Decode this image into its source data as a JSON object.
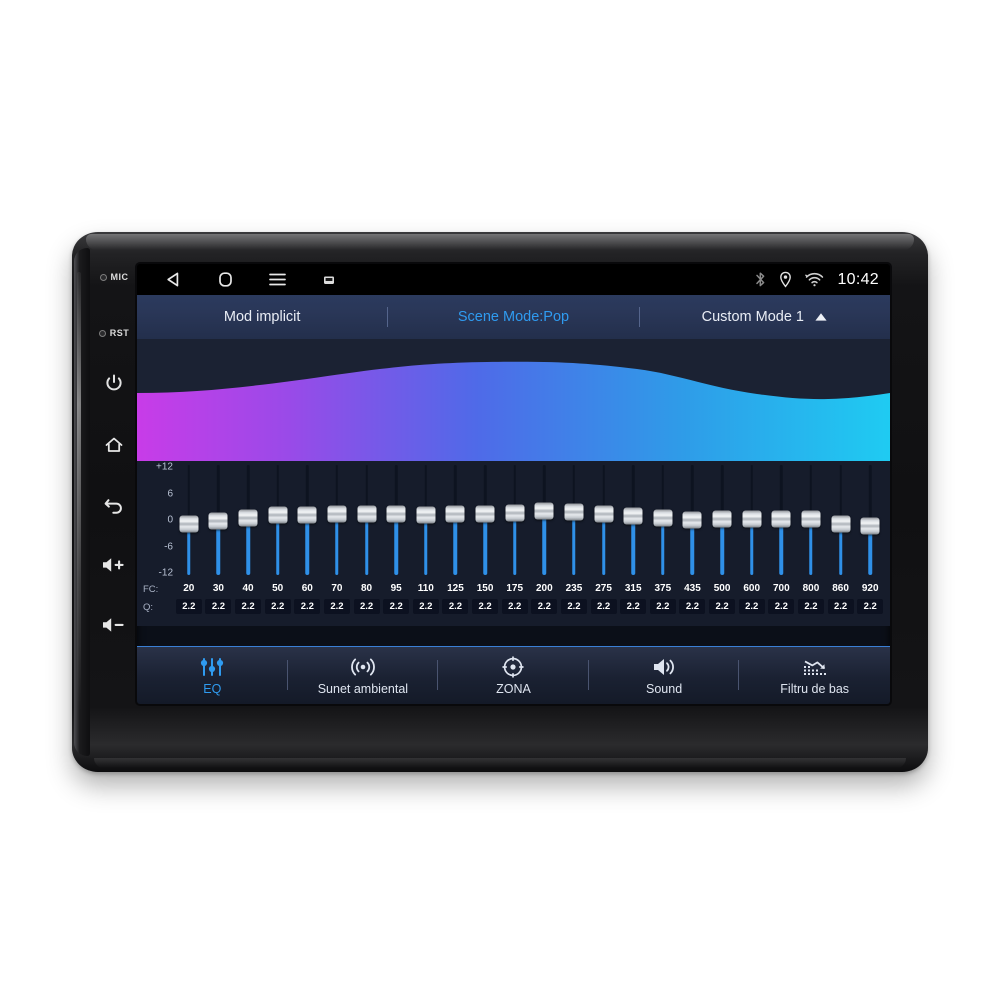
{
  "device": {
    "side_buttons": [
      {
        "name": "mic",
        "label": "MIC",
        "type": "dot"
      },
      {
        "name": "reset",
        "label": "RST",
        "type": "dot"
      },
      {
        "name": "power",
        "label": "",
        "type": "power-icon"
      },
      {
        "name": "home",
        "label": "",
        "type": "home-icon"
      },
      {
        "name": "back",
        "label": "",
        "type": "back-icon"
      },
      {
        "name": "volume-up",
        "label": "+",
        "type": "volume-up-icon"
      },
      {
        "name": "volume-down",
        "label": "−",
        "type": "volume-down-icon"
      }
    ]
  },
  "statusbar": {
    "nav": [
      {
        "name": "back-icon",
        "glyph": "triangle-left"
      },
      {
        "name": "home-icon",
        "glyph": "squircle"
      },
      {
        "name": "recents-menu-icon",
        "glyph": "hamburger"
      },
      {
        "name": "screenshot-icon",
        "glyph": "small-screen"
      }
    ],
    "indicators": [
      {
        "name": "bluetooth-icon"
      },
      {
        "name": "location-icon"
      },
      {
        "name": "wifi-icon"
      }
    ],
    "clock": "10:42"
  },
  "modebar": {
    "default_mode_label": "Mod implicit",
    "scene_mode_label": "Scene Mode:Pop",
    "custom_mode_label": "Custom Mode 1",
    "expand_caret": "caret-up-icon",
    "active_color": "#2f9bf0"
  },
  "wave": {
    "gradient_start": "#c040e8",
    "gradient_mid": "#4f6ae8",
    "gradient_end": "#22c6f0",
    "background": "#1b2233"
  },
  "equalizer": {
    "scale_labels": [
      "+12",
      "6",
      "0",
      "-6",
      "-12"
    ],
    "fc_row_label": "FC:",
    "q_row_label": "Q:",
    "range_db": [
      -12,
      12
    ],
    "bands": [
      {
        "fc": "20",
        "q": "2.2",
        "gain": -0.9
      },
      {
        "fc": "30",
        "q": "2.2",
        "gain": -0.2
      },
      {
        "fc": "40",
        "q": "2.2",
        "gain": 0.5
      },
      {
        "fc": "50",
        "q": "2.2",
        "gain": 1.1
      },
      {
        "fc": "60",
        "q": "2.2",
        "gain": 1.1
      },
      {
        "fc": "70",
        "q": "2.2",
        "gain": 1.3
      },
      {
        "fc": "80",
        "q": "2.2",
        "gain": 1.3
      },
      {
        "fc": "95",
        "q": "2.2",
        "gain": 1.3
      },
      {
        "fc": "110",
        "q": "2.2",
        "gain": 1.1
      },
      {
        "fc": "125",
        "q": "2.2",
        "gain": 1.4
      },
      {
        "fc": "150",
        "q": "2.2",
        "gain": 1.4
      },
      {
        "fc": "175",
        "q": "2.2",
        "gain": 1.5
      },
      {
        "fc": "200",
        "q": "2.2",
        "gain": 2.0
      },
      {
        "fc": "235",
        "q": "2.2",
        "gain": 1.7
      },
      {
        "fc": "275",
        "q": "2.2",
        "gain": 1.3
      },
      {
        "fc": "315",
        "q": "2.2",
        "gain": 1.0
      },
      {
        "fc": "375",
        "q": "2.2",
        "gain": 0.5
      },
      {
        "fc": "435",
        "q": "2.2",
        "gain": 0.1
      },
      {
        "fc": "500",
        "q": "2.2",
        "gain": 0.3
      },
      {
        "fc": "600",
        "q": "2.2",
        "gain": 0.3
      },
      {
        "fc": "700",
        "q": "2.2",
        "gain": 0.2
      },
      {
        "fc": "800",
        "q": "2.2",
        "gain": 0.2
      },
      {
        "fc": "860",
        "q": "2.2",
        "gain": -0.8
      },
      {
        "fc": "920",
        "q": "2.2",
        "gain": -1.4
      }
    ]
  },
  "tabs": [
    {
      "label": "EQ",
      "icon": "equalizer-sliders-icon",
      "active": true
    },
    {
      "label": "Sunet ambiental",
      "icon": "surround-sound-icon",
      "active": false
    },
    {
      "label": "ZONA",
      "icon": "zone-target-icon",
      "active": false
    },
    {
      "label": "Sound",
      "icon": "speaker-icon",
      "active": false
    },
    {
      "label": "Filtru de bas",
      "icon": "bass-filter-icon",
      "active": false
    }
  ]
}
